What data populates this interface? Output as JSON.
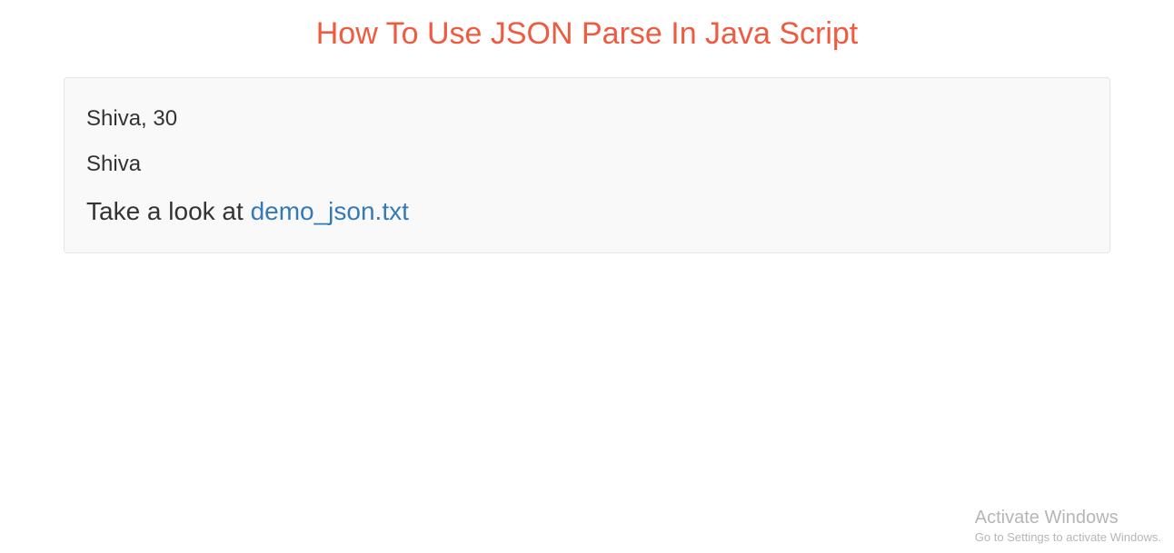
{
  "header": {
    "title": "How To Use JSON Parse In Java Script"
  },
  "content": {
    "line1": "Shiva, 30",
    "line2": "Shiva",
    "line3_prefix": "Take a look at ",
    "link_text": "demo_json.txt"
  },
  "watermark": {
    "title": "Activate Windows",
    "subtitle": "Go to Settings to activate Windows."
  }
}
